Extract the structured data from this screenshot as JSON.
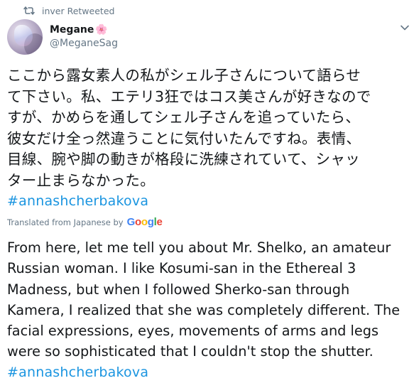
{
  "retweet": {
    "text": "inver Retweeted",
    "icon": "retweet-icon"
  },
  "author": {
    "display_name": "Megane",
    "emoji": "🌸",
    "handle": "@MeganeSag"
  },
  "tweet": {
    "lines": [
      "ここから露女素人の私がシェル子さんについて語らせ",
      "て下さい。私、エテリ3狂ではコス美さんが好きなので",
      "すが、かめらを通してシェル子さんを追っていたら、",
      "彼女だけ全っ然違うことに気付いたんですね。表情、",
      "目線、腕や脚の動きが格段に洗練されていて、シャッ",
      "ター止まらなかった。"
    ],
    "hashtag": "#annashcherbakova"
  },
  "translation_label": {
    "prefix": "Translated from Japanese by",
    "brand_letters": [
      "G",
      "o",
      "o",
      "g",
      "l",
      "e"
    ],
    "brand_colors": [
      "#4285f4",
      "#ea4335",
      "#fbbc05",
      "#4285f4",
      "#34a853",
      "#ea4335"
    ]
  },
  "translation": {
    "lines": [
      "From here, let me tell you about Mr. Shelko, an amateur",
      "Russian woman. I like Kosumi-san in the Ethereal 3",
      "Madness, but when I followed Sherko-san through",
      "Kamera, I realized that she was completely different. The",
      "facial expressions, eyes, movements of arms and legs",
      "were so sophisticated that I couldn't stop the shutter."
    ],
    "hashtag": "#annashcherbakova"
  },
  "colors": {
    "text": "#14171a",
    "muted": "#657786",
    "link": "#1b95e0"
  }
}
